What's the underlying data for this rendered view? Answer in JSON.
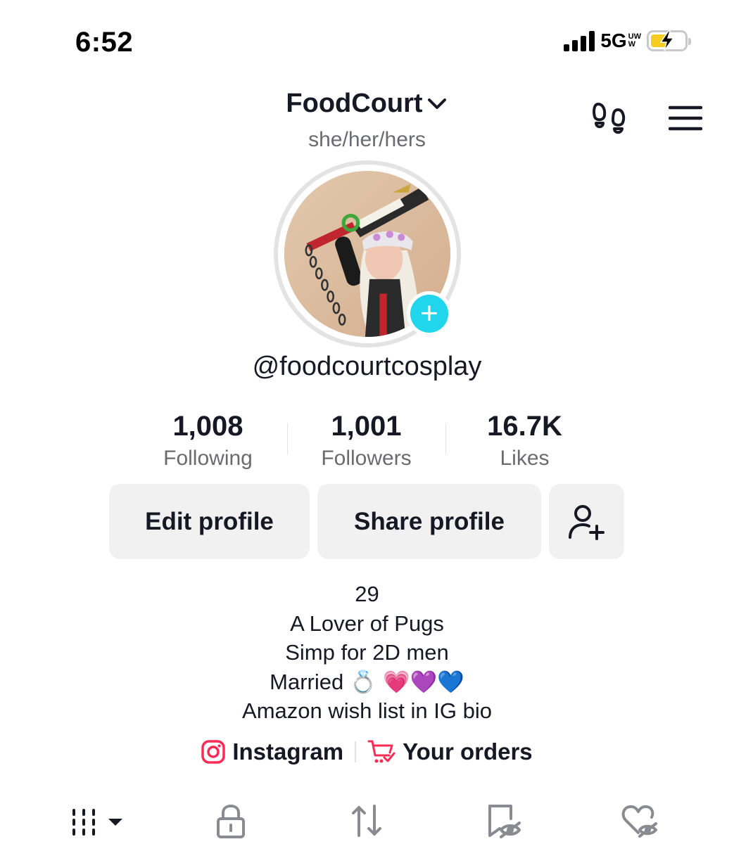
{
  "status_bar": {
    "time": "6:52",
    "network": "5G",
    "network_sub_top": "UW",
    "network_sub_bottom": "W"
  },
  "header": {
    "username": "FoodCourt",
    "pronouns": "she/her/hers"
  },
  "profile": {
    "handle": "@foodcourtcosplay",
    "add_icon": "+"
  },
  "stats": [
    {
      "value": "1,008",
      "label": "Following"
    },
    {
      "value": "1,001",
      "label": "Followers"
    },
    {
      "value": "16.7K",
      "label": "Likes"
    }
  ],
  "actions": {
    "edit_label": "Edit profile",
    "share_label": "Share profile"
  },
  "bio": {
    "line1": "29",
    "line2": "A Lover of Pugs",
    "line3": "Simp for 2D men",
    "line4": "Married 💍 💗💜💙",
    "line5": "Amazon wish list in IG bio"
  },
  "links": {
    "instagram": "Instagram",
    "orders": "Your orders"
  },
  "icons": {
    "instagram": "instagram-icon",
    "orders": "cart-icon",
    "footprints": "footprints-icon",
    "menu": "hamburger-menu-icon"
  },
  "colors": {
    "accent_cyan": "#20d5ec",
    "tiktok_red": "#fe2c55",
    "battery_yellow": "#f5cc1f",
    "button_bg": "#f1f1f2",
    "secondary_text": "#6a6b70"
  }
}
